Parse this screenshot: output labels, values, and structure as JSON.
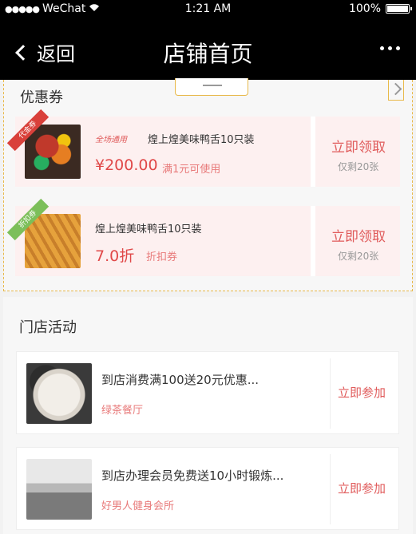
{
  "status_bar": {
    "carrier": "WeChat",
    "time": "1:21 AM",
    "battery": "100%"
  },
  "nav": {
    "back_label": "返回",
    "title": "店铺首页"
  },
  "coupons": {
    "section_title": "优惠券",
    "items": [
      {
        "ribbon": "代金券",
        "tag": "全场通用",
        "name": "煌上煌美味鸭舌10只装",
        "price": "¥200.00",
        "condition": "满1元可使用",
        "claim_label": "立即领取",
        "remaining": "仅剩20张"
      },
      {
        "ribbon": "折扣券",
        "name": "煌上煌美味鸭舌10只装",
        "price": "7.0折",
        "condition": "折扣券",
        "claim_label": "立即领取",
        "remaining": "仅剩20张"
      }
    ]
  },
  "activities": {
    "section_title": "门店活动",
    "items": [
      {
        "title": "到店消费满100送20元优惠...",
        "store": "绿茶餐厅",
        "join_label": "立即参加"
      },
      {
        "title": "到店办理会员免费送10小时锻炼...",
        "store": "好男人健身会所",
        "join_label": "立即参加"
      }
    ]
  },
  "colors": {
    "accent": "#e05b5b",
    "dashed_border": "#e8b94a",
    "nav_bg": "#000000"
  }
}
